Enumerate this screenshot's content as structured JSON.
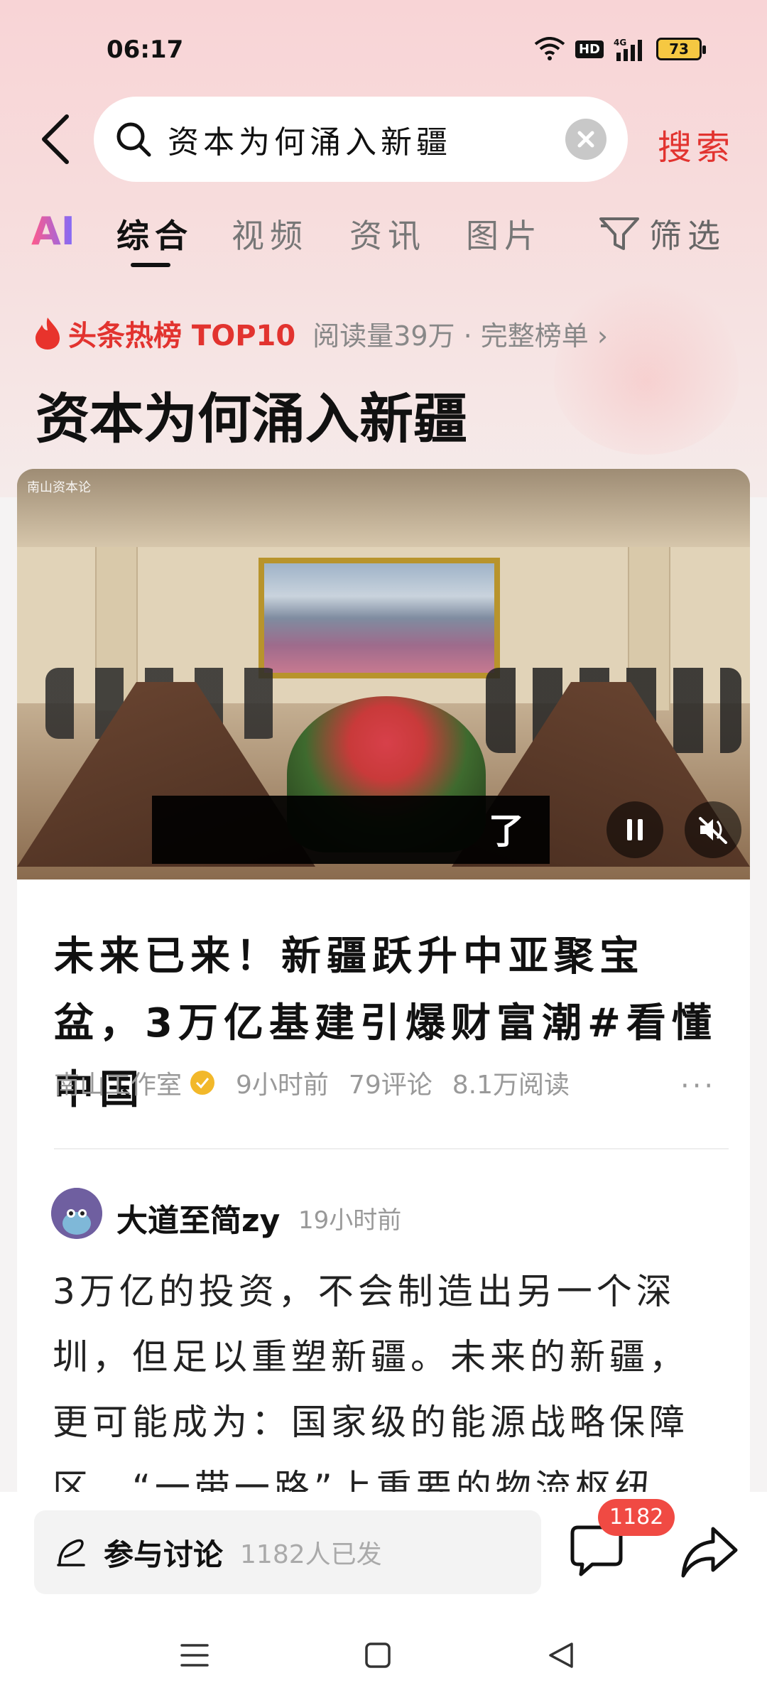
{
  "status_bar": {
    "time": "06:17",
    "network": "4G",
    "hd_label": "HD",
    "battery": "73"
  },
  "search": {
    "query": "资本为何涌入新疆",
    "submit_label": "搜索"
  },
  "tabs": {
    "ai_label": "AI",
    "items": [
      "综合",
      "视频",
      "资讯",
      "图片"
    ],
    "active": "综合",
    "filter_label": "筛选"
  },
  "hot_list": {
    "title": "头条热榜 TOP10",
    "meta": "阅读量39万 · 完整榜单 ›"
  },
  "page_title": "资本为何涌入新疆",
  "video": {
    "watermark": "南山资本论",
    "caption": "了"
  },
  "article": {
    "title": "未来已来！新疆跃升中亚聚宝盆，3万亿基建引爆财富潮#看懂中国",
    "author": "南山工作室",
    "time": "9小时前",
    "comments": "79评论",
    "reads": "8.1万阅读",
    "more": "···"
  },
  "comment": {
    "user": "大道至简zy",
    "time": "19小时前",
    "body": "3万亿的投资，不会制造出另一个深圳，但足以重塑新疆。未来的新疆，更可能成为：国家级的能源战略保障区、“一带一路”上重要的物流枢纽"
  },
  "bottom_bar": {
    "discuss_label": "参与讨论",
    "discuss_count": "1182人已发",
    "comment_badge": "1182"
  },
  "colors": {
    "accent": "#e2332f",
    "badge": "#f04a43",
    "verified": "#f2b82a"
  },
  "icons": [
    "back-arrow-icon",
    "search-icon",
    "clear-icon",
    "filter-icon",
    "flame-icon",
    "verified-icon",
    "pause-icon",
    "mute-icon",
    "pen-icon",
    "comment-icon",
    "share-icon",
    "menu-icon",
    "home-icon",
    "back-nav-icon"
  ]
}
